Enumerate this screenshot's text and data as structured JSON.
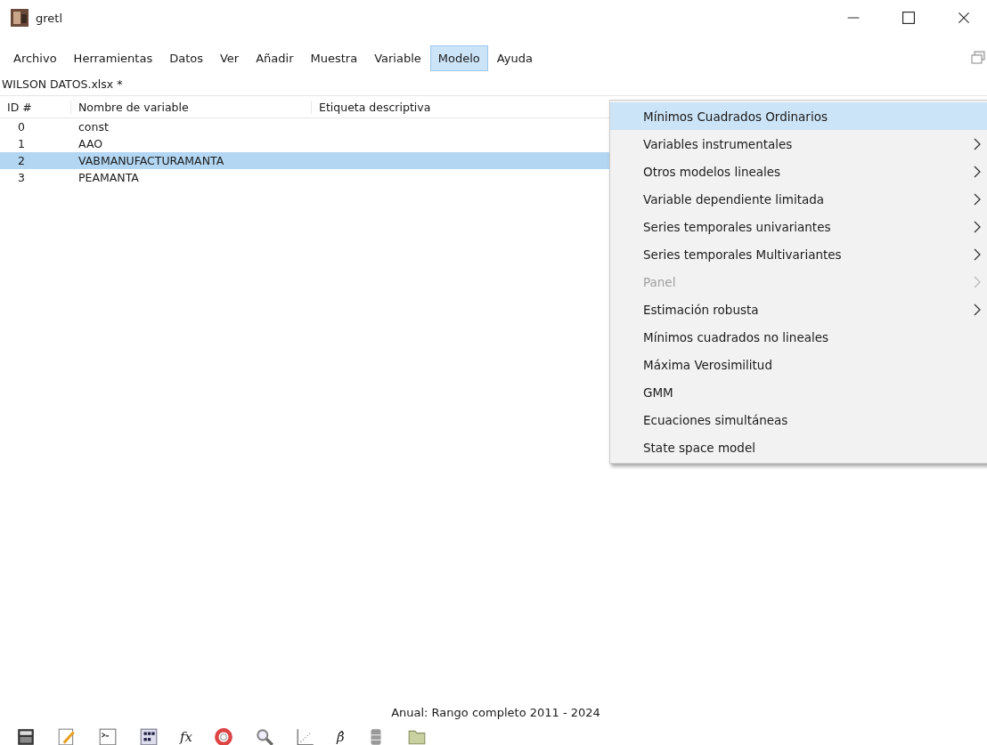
{
  "window": {
    "title": "gretl"
  },
  "menubar": [
    {
      "label": "Archivo",
      "selected": false
    },
    {
      "label": "Herramientas",
      "selected": false
    },
    {
      "label": "Datos",
      "selected": false
    },
    {
      "label": "Ver",
      "selected": false
    },
    {
      "label": "Añadir",
      "selected": false
    },
    {
      "label": "Muestra",
      "selected": false
    },
    {
      "label": "Variable",
      "selected": false
    },
    {
      "label": "Modelo",
      "selected": true
    },
    {
      "label": "Ayuda",
      "selected": false
    }
  ],
  "file_label": "WILSON DATOS.xlsx *",
  "table": {
    "columns": [
      "ID #",
      "Nombre de variable",
      "Etiqueta descriptiva"
    ],
    "rows": [
      {
        "id": "0",
        "name": "const",
        "selected": false
      },
      {
        "id": "1",
        "name": "AAO",
        "selected": false
      },
      {
        "id": "2",
        "name": "VABMANUFACTURAMANTA",
        "selected": true
      },
      {
        "id": "3",
        "name": "PEAMANTA",
        "selected": false
      }
    ]
  },
  "menu": [
    {
      "label": "Mínimos Cuadrados Ordinarios",
      "selected": true,
      "disabled": false,
      "submenu": false
    },
    {
      "label": "Variables instrumentales",
      "selected": false,
      "disabled": false,
      "submenu": true
    },
    {
      "label": "Otros modelos lineales",
      "selected": false,
      "disabled": false,
      "submenu": true
    },
    {
      "label": "Variable dependiente limitada",
      "selected": false,
      "disabled": false,
      "submenu": true
    },
    {
      "label": "Series temporales univariantes",
      "selected": false,
      "disabled": false,
      "submenu": true
    },
    {
      "label": "Series temporales Multivariantes",
      "selected": false,
      "disabled": false,
      "submenu": true
    },
    {
      "label": "Panel",
      "selected": false,
      "disabled": true,
      "submenu": true
    },
    {
      "label": "Estimación robusta",
      "selected": false,
      "disabled": false,
      "submenu": true
    },
    {
      "label": "Mínimos cuadrados no lineales",
      "selected": false,
      "disabled": false,
      "submenu": false
    },
    {
      "label": "Máxima Verosimilitud",
      "selected": false,
      "disabled": false,
      "submenu": false
    },
    {
      "label": "GMM",
      "selected": false,
      "disabled": false,
      "submenu": false
    },
    {
      "label": "Ecuaciones simultáneas",
      "selected": false,
      "disabled": false,
      "submenu": false
    },
    {
      "label": "State space model",
      "selected": false,
      "disabled": false,
      "submenu": false
    }
  ],
  "status_bar": "Anual: Rango completo 2011 - 2024",
  "toolbar": [
    {
      "kind": "calculator"
    },
    {
      "kind": "notepad"
    },
    {
      "kind": "console"
    },
    {
      "kind": "grid"
    },
    {
      "kind": "text",
      "label": "fx"
    },
    {
      "kind": "lifebuoy"
    },
    {
      "kind": "search"
    },
    {
      "kind": "scatter"
    },
    {
      "kind": "text",
      "label": "β̂"
    },
    {
      "kind": "database"
    },
    {
      "kind": "folder"
    }
  ]
}
